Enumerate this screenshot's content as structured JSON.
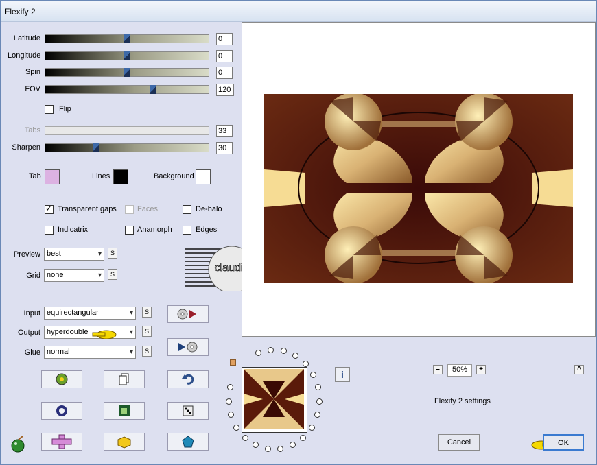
{
  "window": {
    "title": "Flexify 2"
  },
  "sliders": [
    {
      "label": "Latitude",
      "value": "0",
      "pos": 0.5
    },
    {
      "label": "Longitude",
      "value": "0",
      "pos": 0.5
    },
    {
      "label": "Spin",
      "value": "0",
      "pos": 0.5
    },
    {
      "label": "FOV",
      "value": "120",
      "pos": 0.66
    }
  ],
  "flip": {
    "label": "Flip",
    "checked": false
  },
  "tabs": {
    "label": "Tabs",
    "value": "33"
  },
  "sharpen": {
    "label": "Sharpen",
    "value": "30",
    "pos": 0.31
  },
  "colors": {
    "tab": {
      "label": "Tab",
      "color": "#dcb2e2"
    },
    "lines": {
      "label": "Lines",
      "color": "#000000"
    },
    "background": {
      "label": "Background",
      "color": "#ffffff"
    }
  },
  "options": {
    "transparent_gaps": {
      "label": "Transparent gaps",
      "checked": true
    },
    "faces": {
      "label": "Faces",
      "checked": false
    },
    "de_halo": {
      "label": "De-halo",
      "checked": false
    },
    "indicatrix": {
      "label": "Indicatrix",
      "checked": false
    },
    "anamorph": {
      "label": "Anamorph",
      "checked": false
    },
    "edges": {
      "label": "Edges",
      "checked": false
    }
  },
  "preview_select": {
    "label": "Preview",
    "value": "best"
  },
  "grid_select": {
    "label": "Grid",
    "value": "none"
  },
  "input_select": {
    "label": "Input",
    "value": "equirectangular"
  },
  "output_select": {
    "label": "Output",
    "value": "hyperdouble"
  },
  "glue_select": {
    "label": "Glue",
    "value": "normal"
  },
  "save_button_label": "S",
  "watermark": {
    "text": "claudia"
  },
  "zoom": {
    "value": "50%",
    "minus": "–",
    "plus": "+",
    "up": "^"
  },
  "settings_label": "Flexify 2 settings",
  "info_label": "i",
  "buttons": {
    "cancel": "Cancel",
    "ok": "OK"
  }
}
